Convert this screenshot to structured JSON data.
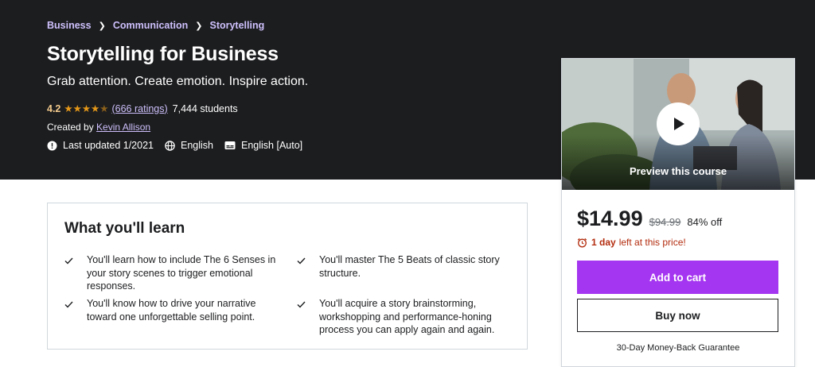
{
  "breadcrumb": [
    "Business",
    "Communication",
    "Storytelling"
  ],
  "course": {
    "title": "Storytelling for Business",
    "subtitle": "Grab attention. Create emotion. Inspire action.",
    "rating": "4.2",
    "rating_stars": 4.2,
    "ratings_link": "(666 ratings)",
    "students": "7,444 students",
    "created_prefix": "Created by",
    "instructor": "Kevin Allison",
    "last_updated": "Last updated 1/2021",
    "language": "English",
    "captions": "English [Auto]"
  },
  "purchase": {
    "preview_label": "Preview this course",
    "price": "$14.99",
    "original_price": "$94.99",
    "discount": "84% off",
    "timer_bold": "1 day",
    "timer_rest": "left at this price!",
    "add_to_cart": "Add to cart",
    "buy_now": "Buy now",
    "guarantee": "30-Day Money-Back Guarantee"
  },
  "learn": {
    "heading": "What you'll learn",
    "items": [
      "You'll learn how to include The 6 Senses in your story scenes to trigger emotional responses.",
      "You'll master The 5 Beats of classic story structure.",
      "You'll know how to drive your narrative toward one unforgettable selling point.",
      "You'll acquire a story brainstorming, workshopping and performance-honing process you can apply again and again."
    ]
  },
  "colors": {
    "hero_bg": "#1c1d1f",
    "link_purple": "#cec0fc",
    "star": "#e59819",
    "accent": "#a435f0",
    "timer_red": "#b32d0f"
  },
  "icons": [
    "chevron-right-icon",
    "star-icon",
    "alert-icon",
    "globe-icon",
    "captions-icon",
    "play-icon",
    "alarm-icon",
    "check-icon"
  ]
}
